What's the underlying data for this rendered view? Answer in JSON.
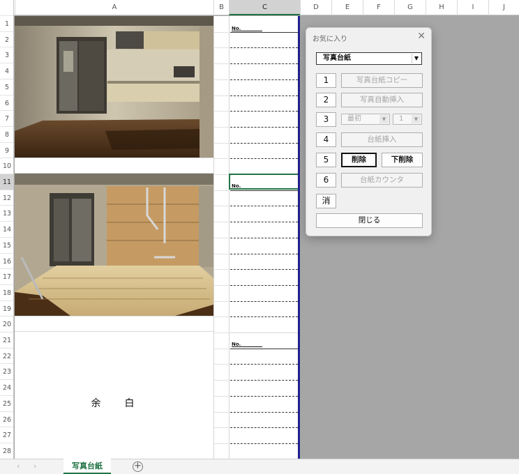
{
  "columns": [
    "A",
    "B",
    "C",
    "D",
    "E",
    "F",
    "G",
    "H",
    "I",
    "J"
  ],
  "rows": [
    "1",
    "2",
    "3",
    "4",
    "5",
    "6",
    "7",
    "8",
    "9",
    "10",
    "11",
    "12",
    "13",
    "14",
    "15",
    "16",
    "17",
    "18",
    "19",
    "20",
    "21",
    "22",
    "23",
    "24",
    "25",
    "26",
    "27",
    "28"
  ],
  "sheet": {
    "no_label": "No.",
    "blank_text": "余白"
  },
  "tabs": {
    "active": "写真台紙",
    "prev_icon": "‹",
    "next_icon": "›",
    "add_icon": "+"
  },
  "dialog": {
    "title": "お気に入り",
    "close_icon": "✕",
    "dropdown_value": "写真台紙",
    "buttons": [
      {
        "num": "1",
        "label": "写真台紙コピー"
      },
      {
        "num": "2",
        "label": "写真自動挿入"
      },
      {
        "num": "3",
        "first_select": "最初",
        "count_select": "1"
      },
      {
        "num": "4",
        "label": "台紙挿入"
      },
      {
        "num": "5",
        "label_a": "削除",
        "label_b": "下削除"
      },
      {
        "num": "6",
        "label": "台紙カウンタ"
      }
    ],
    "clear_label": "消",
    "close_label": "閉じる"
  }
}
